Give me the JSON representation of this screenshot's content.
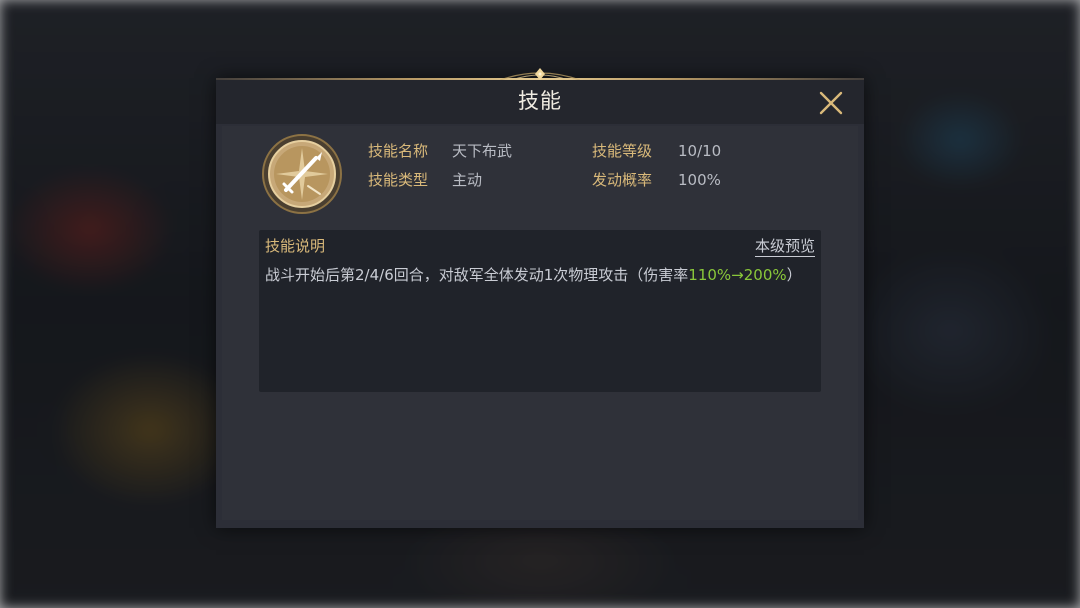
{
  "dialog": {
    "title": "技能",
    "close_icon": "close-icon"
  },
  "skill": {
    "icon": "crossed-swords-compass-icon",
    "name_label": "技能名称",
    "name_value": "天下布武",
    "level_label": "技能等级",
    "level_value": "10/10",
    "type_label": "技能类型",
    "type_value": "主动",
    "rate_label": "发动概率",
    "rate_value": "100%"
  },
  "description": {
    "title": "技能说明",
    "preview_link": "本级预览",
    "text_part1": "战斗开始后第2/4/6回合，对敌军全体发动1次物理攻击（伤害率",
    "text_highlight": "110%→200%",
    "text_part2": "）"
  },
  "colors": {
    "accent_gold": "#d9b97a",
    "highlight_green": "#8ac83a",
    "panel_bg": "#2c2e37"
  }
}
